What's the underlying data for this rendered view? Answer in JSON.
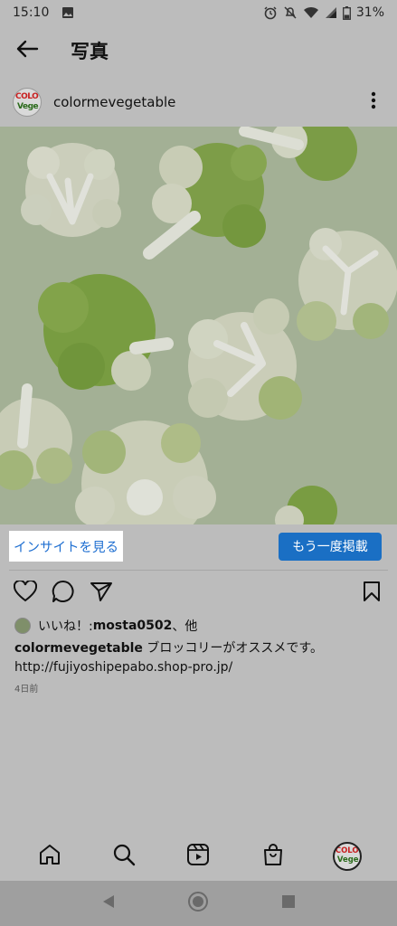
{
  "status_bar": {
    "time": "15:10",
    "battery_percent": "31%",
    "icons": [
      "image-notification-icon",
      "alarm-icon",
      "mute-icon",
      "wifi-icon",
      "signal-icon",
      "battery-icon"
    ]
  },
  "header": {
    "title": "写真",
    "back_icon": "arrow-left-icon"
  },
  "post": {
    "username": "colormevegetable",
    "avatar_logo_top": "COLO",
    "avatar_logo_bottom": "Vege",
    "more_icon": "three-dots-vertical-icon",
    "photo_subject": "broccoli-and-cauliflower-photo"
  },
  "actions": {
    "insight_label": "インサイトを見る",
    "repost_label": "もう一度掲載",
    "icons": [
      "heart-icon",
      "comment-icon",
      "share-icon",
      "bookmark-icon"
    ]
  },
  "likes": {
    "prefix": "いいね！: ",
    "user": "mosta0502",
    "suffix": "、他"
  },
  "caption": {
    "user": "colormevegetable",
    "text": " ブロッコリーがオススメです。",
    "link": "http://fujiyoshipepabo.shop-pro.jp/",
    "timestamp": "4日前"
  },
  "bottom_nav": {
    "items": [
      "home-icon",
      "search-icon",
      "reels-icon",
      "shop-icon",
      "profile-avatar"
    ],
    "avatar_logo_top": "COLO",
    "avatar_logo_bottom": "Vege"
  },
  "system_nav": {
    "items": [
      "back-triangle-icon",
      "home-circle-icon",
      "recents-square-icon"
    ]
  },
  "colors": {
    "overlay_bg": "#bcbcbc",
    "link_blue": "#1f6fd1",
    "button_blue": "#1a6fc4",
    "photo_bg": "#a9b998",
    "broccoli_green": "#6e9a2c",
    "cauliflower_white": "#e6ead8"
  }
}
